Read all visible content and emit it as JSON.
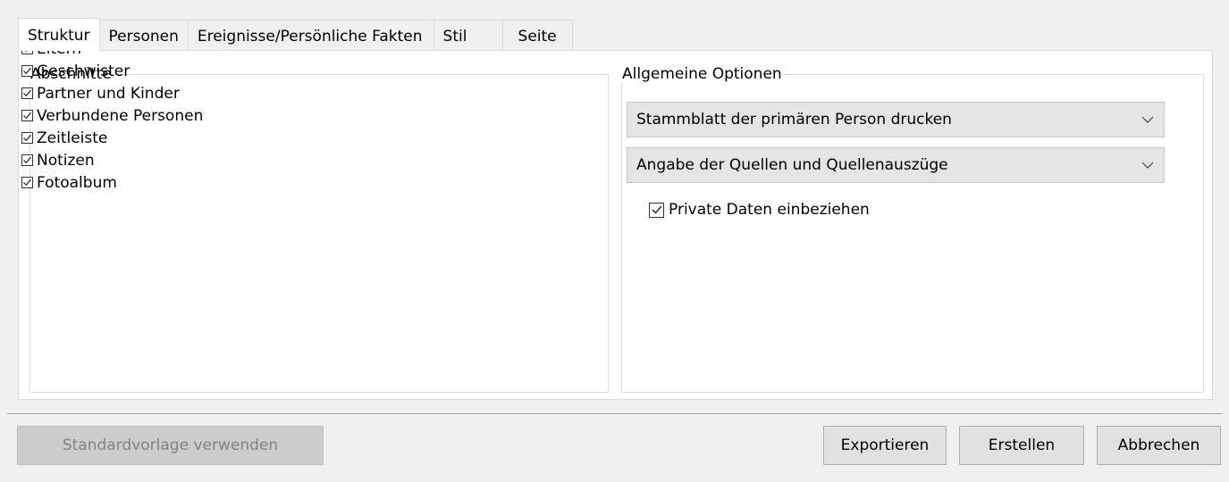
{
  "tabs": [
    {
      "label": "Struktur",
      "active": true
    },
    {
      "label": "Personen",
      "active": false
    },
    {
      "label": "Ereignisse/Persönliche Fakten",
      "active": false
    },
    {
      "label": "Stil",
      "active": false
    },
    {
      "label": "Seite",
      "active": false
    }
  ],
  "sections": {
    "legend": "Abschnitte",
    "items": [
      {
        "label": "Eltern",
        "checked": true
      },
      {
        "label": "Geschwister",
        "checked": true
      },
      {
        "label": "Partner und Kinder",
        "checked": true
      },
      {
        "label": "Verbundene Personen",
        "checked": true
      },
      {
        "label": "Zeitleiste",
        "checked": true
      },
      {
        "label": "Notizen",
        "checked": true
      },
      {
        "label": "Fotoalbum",
        "checked": true
      }
    ]
  },
  "options": {
    "legend": "Allgemeine Optionen",
    "print_select": "Stammblatt der primären Person drucken",
    "sources_select": "Angabe der Quellen und Quellenauszüge",
    "private_label": "Private Daten einbeziehen",
    "private_checked": true
  },
  "buttons": {
    "standard": "Standardvorlage verwenden",
    "export": "Exportieren",
    "create": "Erstellen",
    "cancel": "Abbrechen"
  },
  "icons": {
    "checkmark": "checkmark-icon",
    "dropdown": "chevron-down-icon"
  }
}
